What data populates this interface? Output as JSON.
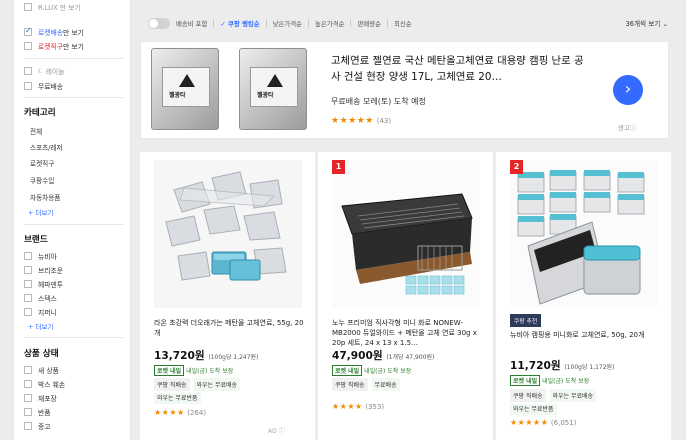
{
  "sidebar": {
    "top_partial": "R.LUX 만 보기",
    "filters_top": [
      {
        "label_blue": "로켓배송",
        "label_rest": "만 보기",
        "checked": true
      },
      {
        "label_blue": "로켓직구",
        "label_rest": "만 보기",
        "checked": false
      }
    ],
    "rewards_label": "레이놀",
    "free_shipping": "무료배송",
    "category_heading": "카테고리",
    "categories": [
      "전체",
      "스포츠/레저",
      "로켓직구",
      "쿠팡수입",
      "자동차용품"
    ],
    "more": "+ 더보기",
    "brand_heading": "브랜드",
    "brands": [
      "뉴비아",
      "브리조운",
      "헤파덴투",
      "스텍스",
      "지퍼니"
    ],
    "brand_more": "+ 더보기",
    "condition_heading": "상품 상태",
    "conditions": [
      "새 상품",
      "박스 훼손",
      "재포장",
      "반품",
      "중고"
    ]
  },
  "filterbar": {
    "toggle_label": "배송비 포함",
    "sort_active": "✓ 쿠팡 랭킹순",
    "sort_options": [
      "낮은가격순",
      "높은가격순",
      "판매량순",
      "최신순"
    ],
    "per_page": "36개씩 보기"
  },
  "ad": {
    "can_label": "젤광타",
    "title": "고체연료 젤연료 국산 메탄올고체연료 대용량 캠핑 난로 공사 건설 현장 양생 17L, 고체연료 20…",
    "delivery": "무료배송 모레(토) 도착 예정",
    "stars": "★★★★★",
    "review_count": "(43)",
    "next_icon": "›",
    "ad_label": "광고ⓘ"
  },
  "products": [
    {
      "rank": "",
      "name": "라온 초강력 더오래가는 메탄올 고체연료, 55g, 20개",
      "price": "13,720원",
      "unit_price": "(100g당 1,247원)",
      "rocket_badge": "로켓 내일",
      "rocket_text": "내일(금) 도착 보장",
      "tags": [
        "쿠팡 직배송",
        "와우는 무료배송"
      ],
      "tags2": "와우는 무료반품",
      "stars": "★★★★",
      "reviews": "(264)",
      "ad_mark": "AD ⓘ"
    },
    {
      "rank": "1",
      "name": "노누 프리미엄 직사각형 미니 화로 NONEW-MB2000 듀얼와이드 + 메탄올 고체 연료 30g x 20p 세트, 24 x 13 x 1.5…",
      "price": "47,900원",
      "unit_price": "(1개당 47,900원)",
      "rocket_badge": "로켓 내일",
      "rocket_text": "내일(금) 도착 보장",
      "tags": [
        "쿠팡 직배송",
        "무료배송"
      ],
      "tags2": "",
      "stars": "★★★★",
      "reviews": "(353)",
      "ad_mark": ""
    },
    {
      "rank": "2",
      "coupang_badge": "쿠팡 추천",
      "name": "뉴비아 캠핑용 미니화로 고체연료, 50g, 20개",
      "price": "11,720원",
      "unit_price": "(100g당 1,172원)",
      "rocket_badge": "로켓 내일",
      "rocket_text": "내일(금) 도착 보장",
      "tags": [
        "쿠팡 직배송",
        "와우는 무료배송"
      ],
      "tags2": "와우는 무료반품",
      "stars": "★★★★★",
      "reviews": "(6,051)",
      "ad_mark": ""
    }
  ],
  "colors": {
    "accent": "#346aff",
    "rank_red": "#e52528",
    "star": "#f28b00"
  }
}
